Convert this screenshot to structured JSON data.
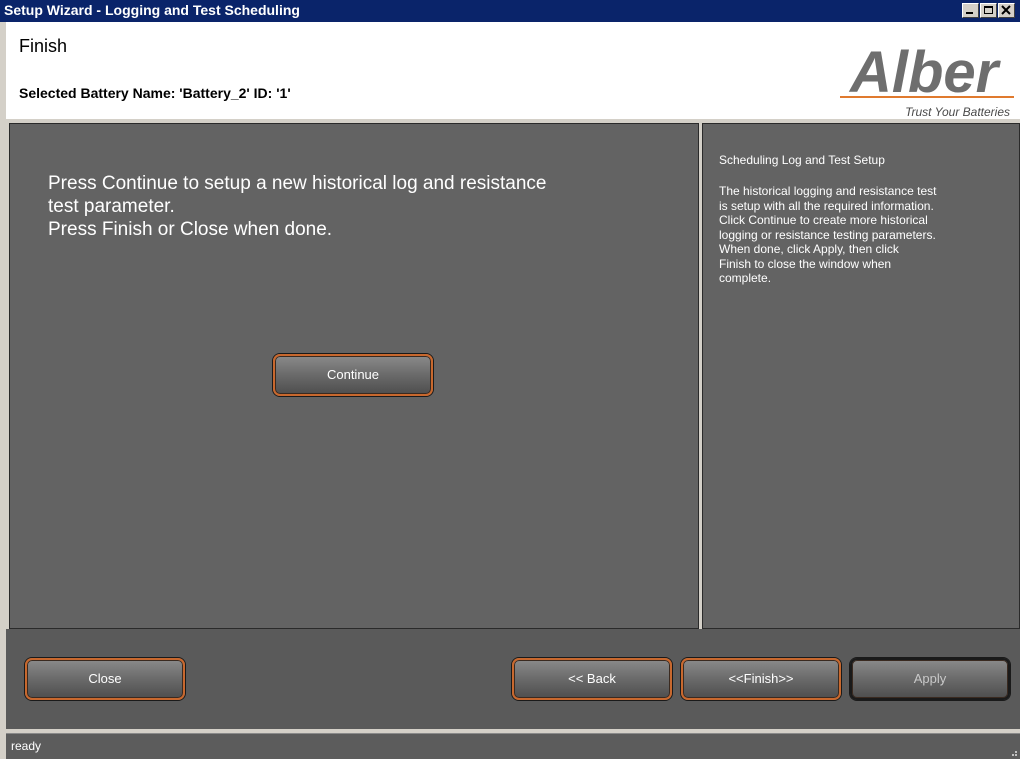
{
  "window": {
    "title": "Setup Wizard - Logging and Test Scheduling"
  },
  "header": {
    "step_title": "Finish",
    "battery_info": "Selected Battery Name: 'Battery_2' ID: '1'",
    "logo": {
      "brand": "Alber",
      "tagline": "Trust Your Batteries"
    }
  },
  "main": {
    "message_lines": [
      "Press Continue to setup a new historical log and resistance",
      "test parameter.",
      "Press Finish or Close when done."
    ],
    "continue_label": "Continue"
  },
  "help": {
    "title": "Scheduling Log and Test Setup",
    "lines": [
      "The historical logging and resistance test",
      "is setup with all the required information.",
      "Click Continue to create more historical",
      "logging or resistance testing parameters.",
      "When done, click Apply, then click",
      "Finish to close the window when",
      "complete."
    ]
  },
  "buttons": {
    "close": "Close",
    "back": "<< Back",
    "finish": "<<Finish>>",
    "apply": "Apply"
  },
  "status": {
    "text": "ready"
  },
  "colors": {
    "titlebar": "#0a246a",
    "panel": "#636363",
    "button_border": "#c8682e",
    "logo_gray": "#6e6e6e",
    "logo_orange": "#e07a2e"
  }
}
